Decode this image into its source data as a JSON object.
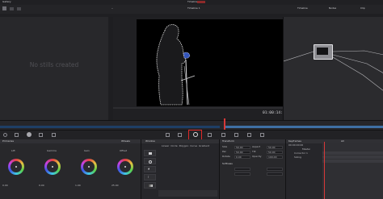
{
  "header": {
    "gallery_tab": "Gallery",
    "timeline_name": "Timeline 1",
    "clip_label": "Clip",
    "top_right_items": [
      "Timeline",
      "Nodes",
      "Clip"
    ]
  },
  "gallery": {
    "empty_message": "No stills created"
  },
  "viewer": {
    "timecode": "01:00:14:05"
  },
  "palette": {
    "primaries_title": "Primaries",
    "wheels_label": "Wheels",
    "window_title": "Window",
    "transform_title": "Transform",
    "keyframes_title": "Keyframes",
    "all_label": "All",
    "window_tabs": [
      "Linear",
      "Circle",
      "Polygon",
      "Curve",
      "Gradient",
      "Delete"
    ],
    "wheels": [
      {
        "name": "Lift",
        "values": [
          "0.00",
          "0.00",
          "0.00",
          "0.00"
        ]
      },
      {
        "name": "Gamma",
        "values": [
          "0.00",
          "0.00",
          "0.00",
          "0.00"
        ]
      },
      {
        "name": "Gain",
        "values": [
          "1.00",
          "1.00",
          "1.00",
          "1.00"
        ]
      },
      {
        "name": "Offset",
        "values": [
          "25.00",
          "25.00",
          "25.00"
        ]
      }
    ],
    "transform_fields": [
      {
        "label": "Size",
        "value": "50.00"
      },
      {
        "label": "Aspect",
        "value": "50.00"
      },
      {
        "label": "Pan",
        "value": "50.00"
      },
      {
        "label": "Tilt",
        "value": "50.00"
      },
      {
        "label": "Rotate",
        "value": "0.00"
      },
      {
        "label": "Opacity",
        "value": "100.00"
      }
    ],
    "softness_title": "Softness",
    "keyframe_rows": [
      "Master",
      "Corrector 1",
      "Sizing"
    ],
    "keyframe_timecode": "00:00:00:00"
  }
}
